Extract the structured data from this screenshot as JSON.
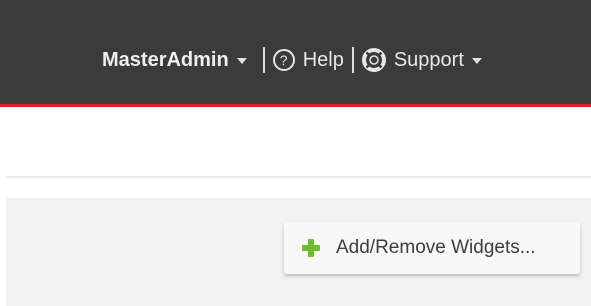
{
  "header": {
    "user_menu_label": "MasterAdmin",
    "help_label": "Help",
    "support_label": "Support",
    "help_icon": "question-circle-icon",
    "support_icon": "lifebuoy-icon",
    "background_color": "#3b3b3b",
    "accent_color": "#d9251d"
  },
  "toolbar": {
    "add_remove_widgets_label": "Add/Remove Widgets...",
    "add_icon": "plus-icon",
    "add_icon_color": "#6abf2e"
  }
}
